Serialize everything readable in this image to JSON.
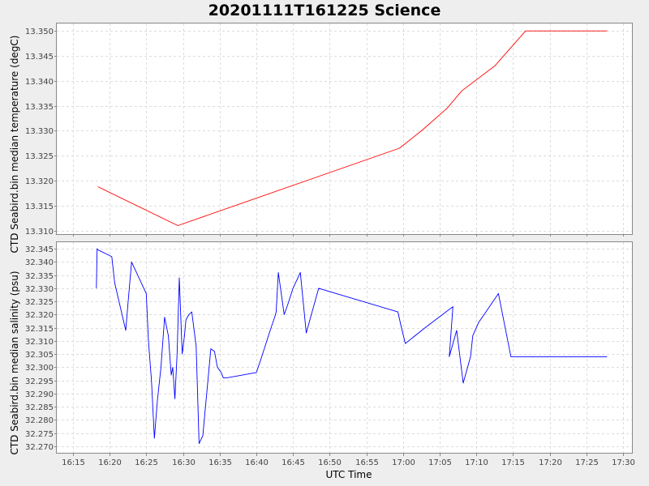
{
  "chart_data": {
    "title": "20201111T161225 Science",
    "xlabel": "UTC Time",
    "x_ticks": [
      "16:15",
      "16:20",
      "16:25",
      "16:30",
      "16:35",
      "16:40",
      "16:45",
      "16:50",
      "16:55",
      "17:00",
      "17:05",
      "17:10",
      "17:15",
      "17:20",
      "17:25",
      "17:30"
    ],
    "x_tick_minutes": [
      975,
      980,
      985,
      990,
      995,
      1000,
      1005,
      1010,
      1015,
      1020,
      1025,
      1030,
      1035,
      1040,
      1045,
      1050
    ],
    "xlim_minutes": [
      972.8,
      1051.2
    ],
    "subplots": [
      {
        "type": "line",
        "ylabel": "CTD Seabird.bin median temperature (degC)",
        "ylim": [
          13.3093,
          13.3515
        ],
        "y_ticks": [
          "13.310",
          "13.315",
          "13.320",
          "13.325",
          "13.330",
          "13.335",
          "13.340",
          "13.345",
          "13.350"
        ],
        "y_tick_values": [
          13.31,
          13.315,
          13.32,
          13.325,
          13.33,
          13.335,
          13.34,
          13.345,
          13.35
        ],
        "color": "#ff0000",
        "x_minutes": [
          978.4,
          989.3,
          1019.5,
          1022.5,
          1026.0,
          1028.0,
          1032.5,
          1036.7,
          1047.8
        ],
        "values": [
          13.3188,
          13.311,
          13.3265,
          13.33,
          13.3345,
          13.338,
          13.343,
          13.35,
          13.35
        ]
      },
      {
        "type": "line",
        "ylabel": "CTD Seabird.bin median salinity (psu)",
        "ylim": [
          32.2675,
          32.3475
        ],
        "y_ticks": [
          "32.270",
          "32.275",
          "32.280",
          "32.285",
          "32.290",
          "32.295",
          "32.300",
          "32.305",
          "32.310",
          "32.315",
          "32.320",
          "32.325",
          "32.330",
          "32.335",
          "32.340",
          "32.345"
        ],
        "y_tick_values": [
          32.27,
          32.275,
          32.28,
          32.285,
          32.29,
          32.295,
          32.3,
          32.305,
          32.31,
          32.315,
          32.32,
          32.325,
          32.33,
          32.335,
          32.34,
          32.345
        ],
        "color": "#0000ff",
        "x_minutes": [
          978.2,
          978.3,
          978.5,
          980.3,
          980.7,
          982.2,
          982.5,
          983.0,
          985.0,
          985.3,
          985.7,
          986.1,
          986.5,
          987.0,
          987.5,
          988.0,
          988.4,
          988.6,
          988.9,
          989.2,
          989.5,
          989.9,
          990.2,
          990.4,
          990.8,
          991.2,
          991.8,
          992.2,
          992.7,
          993.3,
          993.8,
          994.3,
          994.7,
          995.2,
          995.5,
          996.0,
          1000.0,
          1000.5,
          1001.2,
          1002.0,
          1002.5,
          1002.7,
          1003.0,
          1003.8,
          1004.3,
          1005.0,
          1006.0,
          1006.8,
          1008.5,
          1019.3,
          1019.7,
          1020.3,
          1023.0,
          1026.8,
          1026.3,
          1027.3,
          1028.2,
          1029.2,
          1029.5,
          1030.3,
          1031.3,
          1033.0,
          1034.7,
          1036.3,
          1036.8,
          1047.8
        ],
        "values": [
          32.33,
          32.345,
          32.3445,
          32.342,
          32.332,
          32.314,
          32.324,
          32.34,
          32.328,
          32.31,
          32.295,
          32.273,
          32.287,
          32.3,
          32.319,
          32.312,
          32.297,
          32.3,
          32.288,
          32.305,
          32.334,
          32.305,
          32.312,
          32.318,
          32.32,
          32.321,
          32.308,
          32.271,
          32.274,
          32.292,
          32.307,
          32.306,
          32.3,
          32.298,
          32.296,
          32.296,
          32.298,
          32.302,
          32.308,
          32.315,
          32.319,
          32.321,
          32.336,
          32.32,
          32.324,
          32.33,
          32.336,
          32.313,
          32.33,
          32.321,
          32.316,
          32.309,
          32.315,
          32.323,
          32.304,
          32.314,
          32.294,
          32.304,
          32.312,
          32.317,
          32.321,
          32.328,
          32.304,
          32.304,
          32.304,
          32.304
        ]
      }
    ]
  }
}
